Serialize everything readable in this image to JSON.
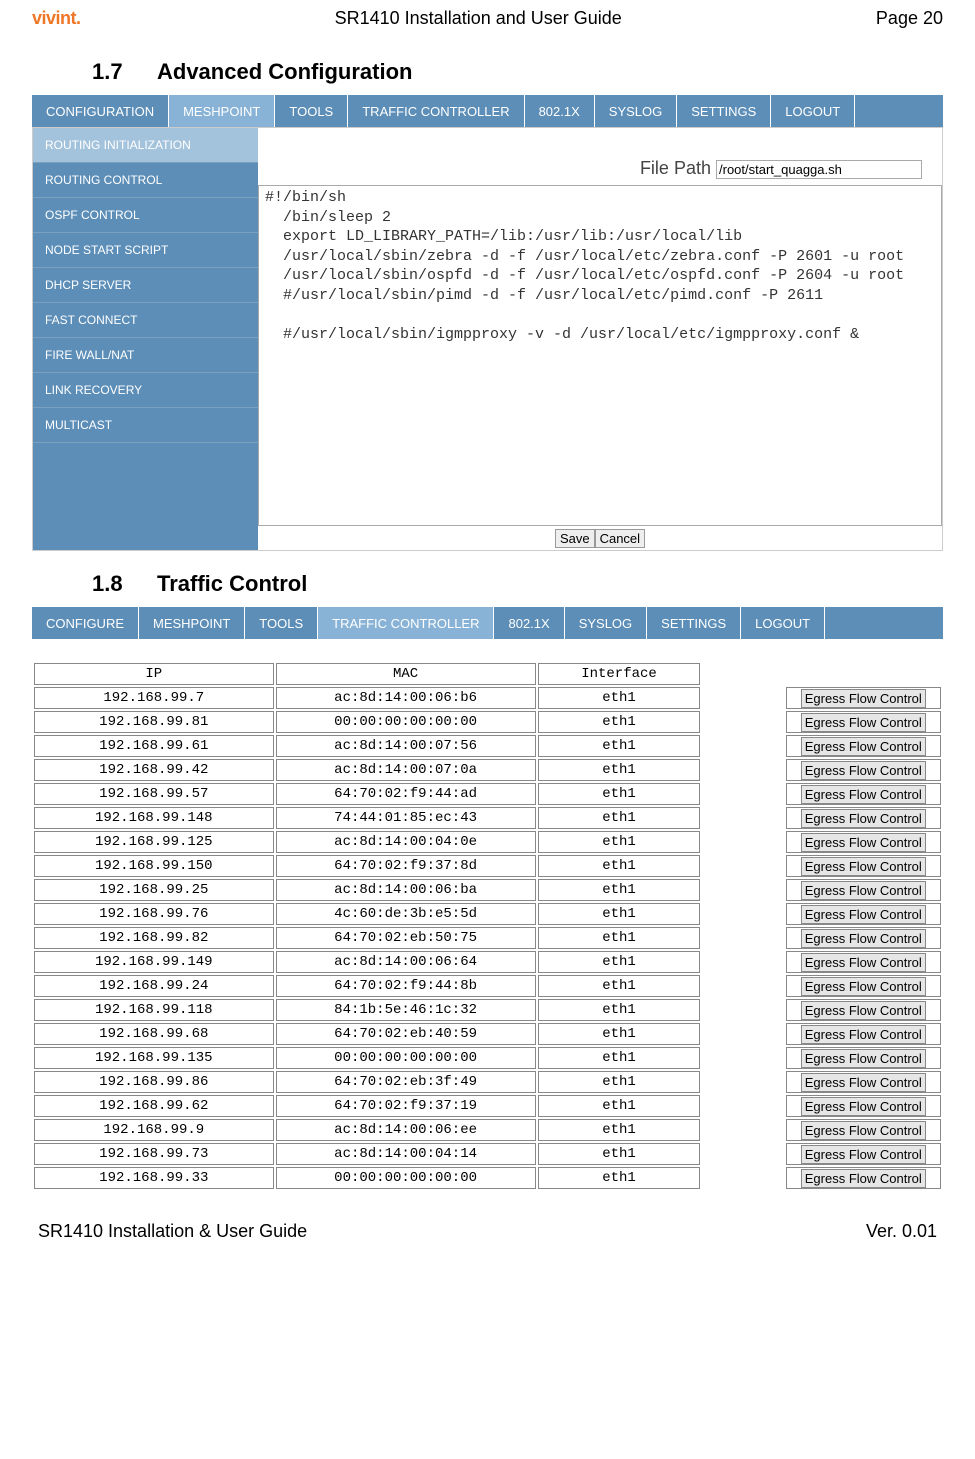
{
  "header": {
    "logo": "vivint.",
    "title": "SR1410 Installation and User Guide",
    "page": "Page 20"
  },
  "sections": {
    "s1num": "1.7",
    "s1": "Advanced Configuration",
    "s2num": "1.8",
    "s2": "Traffic Control"
  },
  "nav1": {
    "t0": "CONFIGURATION",
    "t1": "MESHPOINT",
    "t2": "TOOLS",
    "t3": "TRAFFIC CONTROLLER",
    "t4": "802.1X",
    "t5": "SYSLOG",
    "t6": "SETTINGS",
    "t7": "LOGOUT"
  },
  "sidebar": {
    "i0": "ROUTING INITIALIZATION",
    "i1": "ROUTING CONTROL",
    "i2": "OSPF CONTROL",
    "i3": "NODE START SCRIPT",
    "i4": "DHCP SERVER",
    "i5": "FAST CONNECT",
    "i6": "FIRE WALL/NAT",
    "i7": "LINK RECOVERY",
    "i8": "MULTICAST"
  },
  "file": {
    "label": "File Path",
    "value": "/root/start_quagga.sh"
  },
  "script": "#!/bin/sh\n  /bin/sleep 2\n  export LD_LIBRARY_PATH=/lib:/usr/lib:/usr/local/lib\n  /usr/local/sbin/zebra -d -f /usr/local/etc/zebra.conf -P 2601 -u root\n  /usr/local/sbin/ospfd -d -f /usr/local/etc/ospfd.conf -P 2604 -u root\n  #/usr/local/sbin/pimd -d -f /usr/local/etc/pimd.conf -P 2611\n\n  #/usr/local/sbin/igmpproxy -v -d /usr/local/etc/igmpproxy.conf &",
  "buttons": {
    "save": "Save",
    "cancel": "Cancel"
  },
  "nav2": {
    "t0": "CONFIGURE",
    "t1": "MESHPOINT",
    "t2": "TOOLS",
    "t3": "TRAFFIC CONTROLLER",
    "t4": "802.1X",
    "t5": "SYSLOG",
    "t6": "SETTINGS",
    "t7": "LOGOUT"
  },
  "tc": {
    "hdr": {
      "ip": "IP",
      "mac": "MAC",
      "iface": "Interface"
    },
    "btn": "Egress Flow Control",
    "rows": [
      {
        "ip": "192.168.99.7",
        "mac": "ac:8d:14:00:06:b6",
        "if": "eth1"
      },
      {
        "ip": "192.168.99.81",
        "mac": "00:00:00:00:00:00",
        "if": "eth1"
      },
      {
        "ip": "192.168.99.61",
        "mac": "ac:8d:14:00:07:56",
        "if": "eth1"
      },
      {
        "ip": "192.168.99.42",
        "mac": "ac:8d:14:00:07:0a",
        "if": "eth1"
      },
      {
        "ip": "192.168.99.57",
        "mac": "64:70:02:f9:44:ad",
        "if": "eth1"
      },
      {
        "ip": "192.168.99.148",
        "mac": "74:44:01:85:ec:43",
        "if": "eth1"
      },
      {
        "ip": "192.168.99.125",
        "mac": "ac:8d:14:00:04:0e",
        "if": "eth1"
      },
      {
        "ip": "192.168.99.150",
        "mac": "64:70:02:f9:37:8d",
        "if": "eth1"
      },
      {
        "ip": "192.168.99.25",
        "mac": "ac:8d:14:00:06:ba",
        "if": "eth1"
      },
      {
        "ip": "192.168.99.76",
        "mac": "4c:60:de:3b:e5:5d",
        "if": "eth1"
      },
      {
        "ip": "192.168.99.82",
        "mac": "64:70:02:eb:50:75",
        "if": "eth1"
      },
      {
        "ip": "192.168.99.149",
        "mac": "ac:8d:14:00:06:64",
        "if": "eth1"
      },
      {
        "ip": "192.168.99.24",
        "mac": "64:70:02:f9:44:8b",
        "if": "eth1"
      },
      {
        "ip": "192.168.99.118",
        "mac": "84:1b:5e:46:1c:32",
        "if": "eth1"
      },
      {
        "ip": "192.168.99.68",
        "mac": "64:70:02:eb:40:59",
        "if": "eth1"
      },
      {
        "ip": "192.168.99.135",
        "mac": "00:00:00:00:00:00",
        "if": "eth1"
      },
      {
        "ip": "192.168.99.86",
        "mac": "64:70:02:eb:3f:49",
        "if": "eth1"
      },
      {
        "ip": "192.168.99.62",
        "mac": "64:70:02:f9:37:19",
        "if": "eth1"
      },
      {
        "ip": "192.168.99.9",
        "mac": "ac:8d:14:00:06:ee",
        "if": "eth1"
      },
      {
        "ip": "192.168.99.73",
        "mac": "ac:8d:14:00:04:14",
        "if": "eth1"
      },
      {
        "ip": "192.168.99.33",
        "mac": "00:00:00:00:00:00",
        "if": "eth1"
      }
    ]
  },
  "footer": {
    "left": "SR1410 Installation & User Guide",
    "right": "Ver. 0.01"
  }
}
